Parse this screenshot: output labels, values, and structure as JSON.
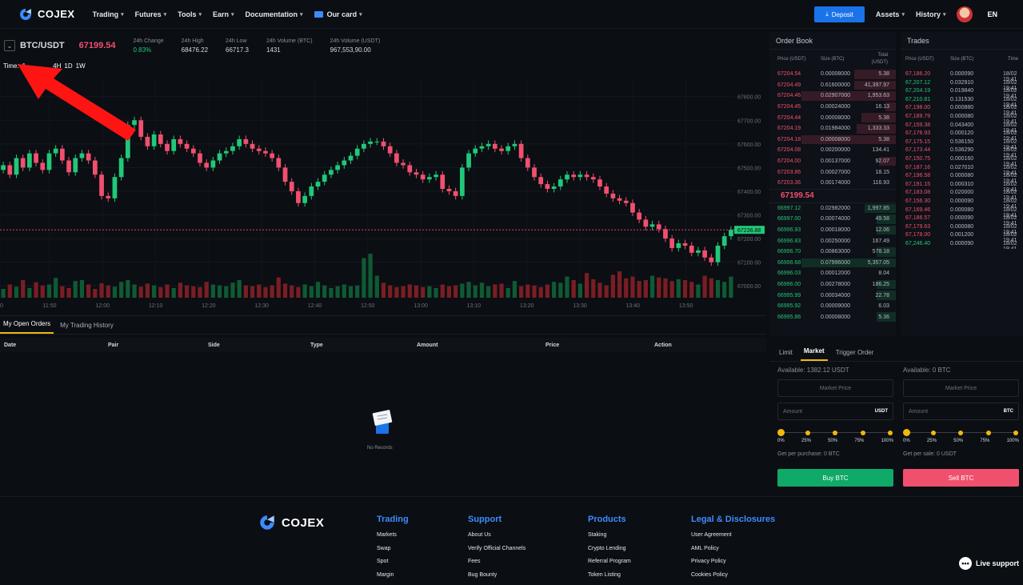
{
  "nav": {
    "brand": "COJEX",
    "items": [
      {
        "label": "Trading"
      },
      {
        "label": "Futures"
      },
      {
        "label": "Tools"
      },
      {
        "label": "Earn"
      },
      {
        "label": "Documentation"
      },
      {
        "label": "Our card"
      }
    ],
    "deposit": "Deposit",
    "assets": "Assets",
    "history": "History",
    "lang": "EN",
    "accent": "#1a73e8"
  },
  "ticker": {
    "pair": "BTC/USDT",
    "price": "67199.54",
    "stats": [
      {
        "label": "24h Change",
        "value": "0.83%",
        "positive": true
      },
      {
        "label": "24h High",
        "value": "68476.22"
      },
      {
        "label": "24h Low",
        "value": "66717.3"
      },
      {
        "label": "24h Volume (BTC)",
        "value": "1431"
      },
      {
        "label": "24h Volume (USDT)",
        "value": "967,553,90.00"
      }
    ]
  },
  "timebar": {
    "label": "Time:",
    "periods": [
      "1",
      "4H",
      "1D",
      "1W"
    ]
  },
  "chart_data": {
    "type": "candlestick",
    "ylim": [
      66950,
      67870
    ],
    "yticks": [
      "67800.00",
      "67700.00",
      "67600.00",
      "67500.00",
      "67400.00",
      "67300.00",
      "67200.00",
      "67100.00",
      "67000.00"
    ],
    "xticks": [
      "0",
      "11:50",
      "12:00",
      "12:10",
      "12:20",
      "12:30",
      "12:40",
      "12:50",
      "13:00",
      "13:10",
      "13:20",
      "13:30",
      "13:40",
      "13:50"
    ],
    "current_price_label": "67236.88",
    "current_price": 67236.88,
    "up_color": "#20c878",
    "down_color": "#f0506e",
    "closes": [
      67510,
      67470,
      67540,
      67500,
      67560,
      67520,
      67490,
      67560,
      67580,
      67530,
      67480,
      67540,
      67560,
      67530,
      67470,
      67380,
      67370,
      67460,
      67540,
      67680,
      67700,
      67630,
      67590,
      67640,
      67600,
      67570,
      67620,
      67600,
      67580,
      67560,
      67520,
      67500,
      67530,
      67560,
      67570,
      67590,
      67620,
      67600,
      67580,
      67570,
      67560,
      67540,
      67500,
      67440,
      67400,
      67350,
      67380,
      67420,
      67440,
      67470,
      67490,
      67510,
      67530,
      67550,
      67580,
      67600,
      67610,
      67610,
      67590,
      67560,
      67520,
      67510,
      67480,
      67470,
      67450,
      67460,
      67470,
      67410,
      67400,
      67380,
      67500,
      67560,
      67580,
      67590,
      67600,
      67580,
      67570,
      67590,
      67600,
      67540,
      67500,
      67460,
      67430,
      67410,
      67420,
      67450,
      67470,
      67460,
      67470,
      67460,
      67450,
      67420,
      67390,
      67370,
      67360,
      67350,
      67310,
      67280,
      67250,
      67260,
      67240,
      67200,
      67160,
      67180,
      67170,
      67140,
      67150,
      67120,
      67100,
      67170,
      67210,
      67236.88
    ],
    "volumes": [
      20,
      30,
      25,
      40,
      22,
      35,
      28,
      30,
      45,
      26,
      22,
      38,
      40,
      30,
      20,
      33,
      28,
      25,
      36,
      40,
      30,
      25,
      32,
      28,
      24,
      30,
      22,
      34,
      28,
      26,
      24,
      36,
      30,
      28,
      26,
      34,
      40,
      28,
      26,
      30,
      24,
      28,
      46,
      32,
      28,
      24,
      30,
      26,
      36,
      28,
      22,
      26,
      30,
      26,
      28,
      90,
      100,
      50,
      34,
      28,
      24,
      26,
      30,
      28,
      24,
      26,
      22,
      30,
      26,
      28,
      32,
      36,
      28,
      34,
      26,
      30,
      32,
      22,
      38,
      26,
      30,
      28,
      24,
      30,
      36,
      34,
      48,
      40,
      32,
      56,
      42,
      34,
      28,
      52,
      60,
      44,
      48,
      38,
      40,
      50,
      46,
      44,
      38,
      42,
      40,
      36,
      30,
      50,
      44,
      40,
      36,
      48
    ]
  },
  "bottom": {
    "tabs": [
      "My Open Orders",
      "My Trading History"
    ],
    "columns": [
      "Date",
      "Pair",
      "Side",
      "Type",
      "Amount",
      "Price",
      "Action"
    ],
    "empty": "No Records"
  },
  "orderbook": {
    "title": "Order Book",
    "headers": {
      "price": "Price (USDT)",
      "size": "Size (BTC)",
      "total": "Total (USDT)"
    },
    "asks": [
      {
        "price": "67204.54",
        "size": "0.00008000",
        "total": "5.38",
        "depth": 0.33
      },
      {
        "price": "67204.49",
        "size": "0.61600000",
        "total": "41,397.97",
        "depth": 0.33
      },
      {
        "price": "67204.46",
        "size": "0.02907000",
        "total": "1,953.63",
        "depth": 0.75
      },
      {
        "price": "67204.45",
        "size": "0.00024000",
        "total": "16.13",
        "depth": 0.08
      },
      {
        "price": "67204.44",
        "size": "0.00008000",
        "total": "5.38",
        "depth": 0.27
      },
      {
        "price": "67204.19",
        "size": "0.01984000",
        "total": "1,333.33",
        "depth": 0.31
      },
      {
        "price": "67204.18",
        "size": "0.00008000",
        "total": "5.38",
        "depth": 0.75
      },
      {
        "price": "67204.08",
        "size": "0.00200000",
        "total": "134.41",
        "depth": 0.0
      },
      {
        "price": "67204.00",
        "size": "0.00137000",
        "total": "92.07",
        "depth": 0.13
      },
      {
        "price": "67203.86",
        "size": "0.00027000",
        "total": "18.15",
        "depth": 0.0
      },
      {
        "price": "67203.36",
        "size": "0.00174000",
        "total": "116.93",
        "depth": 0.0
      }
    ],
    "mid": "67199.54",
    "bids": [
      {
        "price": "66997.12",
        "size": "0.02982000",
        "total": "1,997.85",
        "depth": 0.25
      },
      {
        "price": "66997.00",
        "size": "0.00074000",
        "total": "49.58",
        "depth": 0.15
      },
      {
        "price": "66996.93",
        "size": "0.00018000",
        "total": "12.06",
        "depth": 0.15
      },
      {
        "price": "66996.83",
        "size": "0.00250000",
        "total": "167.49",
        "depth": 0.0
      },
      {
        "price": "66996.70",
        "size": "0.00863000",
        "total": "578.18",
        "depth": 0.15
      },
      {
        "price": "66996.68",
        "size": "0.07996000",
        "total": "5,357.05",
        "depth": 0.75
      },
      {
        "price": "66996.03",
        "size": "0.00012000",
        "total": "8.04",
        "depth": 0.0
      },
      {
        "price": "66996.00",
        "size": "0.00278000",
        "total": "186.25",
        "depth": 0.15
      },
      {
        "price": "66995.99",
        "size": "0.00034000",
        "total": "22.78",
        "depth": 0.15
      },
      {
        "price": "66995.92",
        "size": "0.00009000",
        "total": "6.03",
        "depth": 0.0
      },
      {
        "price": "66995.86",
        "size": "0.00008000",
        "total": "5.36",
        "depth": 0.15
      }
    ]
  },
  "trades": {
    "title": "Trades",
    "headers": {
      "price": "Price (USDT)",
      "size": "Size (BTC)",
      "time": "Time"
    },
    "rows": [
      {
        "price": "67,186.20",
        "size": "0.000090",
        "time": "18/02 19:41",
        "side": "sell"
      },
      {
        "price": "67,207.12",
        "size": "0.032910",
        "time": "18/02 19:41",
        "side": "buy"
      },
      {
        "price": "67,204.19",
        "size": "0.019840",
        "time": "18/02 19:41",
        "side": "buy"
      },
      {
        "price": "67,210.81",
        "size": "0.131530",
        "time": "18/02 19:41",
        "side": "buy"
      },
      {
        "price": "67,198.00",
        "size": "0.000880",
        "time": "18/02 19:41",
        "side": "sell"
      },
      {
        "price": "67,189.79",
        "size": "0.000080",
        "time": "18/02 19:41",
        "side": "sell"
      },
      {
        "price": "67,159.38",
        "size": "0.043400",
        "time": "18/02 19:41",
        "side": "sell"
      },
      {
        "price": "67,176.93",
        "size": "0.000120",
        "time": "18/02 19:41",
        "side": "sell"
      },
      {
        "price": "67,175.15",
        "size": "0.536150",
        "time": "18/02 19:41",
        "side": "sell"
      },
      {
        "price": "67,173.44",
        "size": "0.536290",
        "time": "18/02 19:41",
        "side": "sell"
      },
      {
        "price": "67,150.75",
        "size": "0.000160",
        "time": "18/02 19:41",
        "side": "sell"
      },
      {
        "price": "67,187.16",
        "size": "0.027010",
        "time": "18/02 19:41",
        "side": "sell"
      },
      {
        "price": "67,196.58",
        "size": "0.000080",
        "time": "18/02 19:41",
        "side": "sell"
      },
      {
        "price": "67,191.15",
        "size": "0.000310",
        "time": "18/02 19:41",
        "side": "sell"
      },
      {
        "price": "67,183.08",
        "size": "0.020000",
        "time": "18/02 19:41",
        "side": "sell"
      },
      {
        "price": "67,156.30",
        "size": "0.000090",
        "time": "18/02 19:41",
        "side": "sell"
      },
      {
        "price": "67,169.46",
        "size": "0.000080",
        "time": "18/02 19:41",
        "side": "sell"
      },
      {
        "price": "67,186.57",
        "size": "0.000090",
        "time": "18/02 19:41",
        "side": "sell"
      },
      {
        "price": "67,179.63",
        "size": "0.000080",
        "time": "18/02 19:41",
        "side": "sell"
      },
      {
        "price": "67,178.00",
        "size": "0.001200",
        "time": "18/02 19:41",
        "side": "sell"
      },
      {
        "price": "67,246.40",
        "size": "0.000090",
        "time": "18/02 19:41",
        "side": "buy"
      }
    ]
  },
  "trade_form": {
    "tabs": [
      "Limit",
      "Market",
      "Trigger Order"
    ],
    "buy": {
      "available": "Available: 1382.12  USDT",
      "market": "Market Price",
      "amount": "Amount",
      "unit": "USDT",
      "get": "Get per purchase: 0  BTC",
      "button": "Buy BTC"
    },
    "sell": {
      "available": "Available: 0  BTC",
      "market": "Market Price",
      "amount": "Amount",
      "unit": "BTC",
      "get": "Get per sale: 0  USDT",
      "button": "Sell BTC"
    },
    "percents": [
      "0%",
      "25%",
      "50%",
      "75%",
      "100%"
    ]
  },
  "footer": {
    "brand": "COJEX",
    "columns": [
      {
        "title": "Trading",
        "links": [
          "Markets",
          "Swap",
          "Spot",
          "Margin"
        ]
      },
      {
        "title": "Support",
        "links": [
          "About Us",
          "Verify Official Channels",
          "Fees",
          "Bug Bounty"
        ]
      },
      {
        "title": "Products",
        "links": [
          "Staking",
          "Crypto Lending",
          "Referral Program",
          "Token Listing"
        ]
      },
      {
        "title": "Legal & Disclosures",
        "links": [
          "User Agreement",
          "AML Policy",
          "Privacy Policy",
          "Cookies Policy"
        ]
      }
    ],
    "live": "Live support"
  }
}
